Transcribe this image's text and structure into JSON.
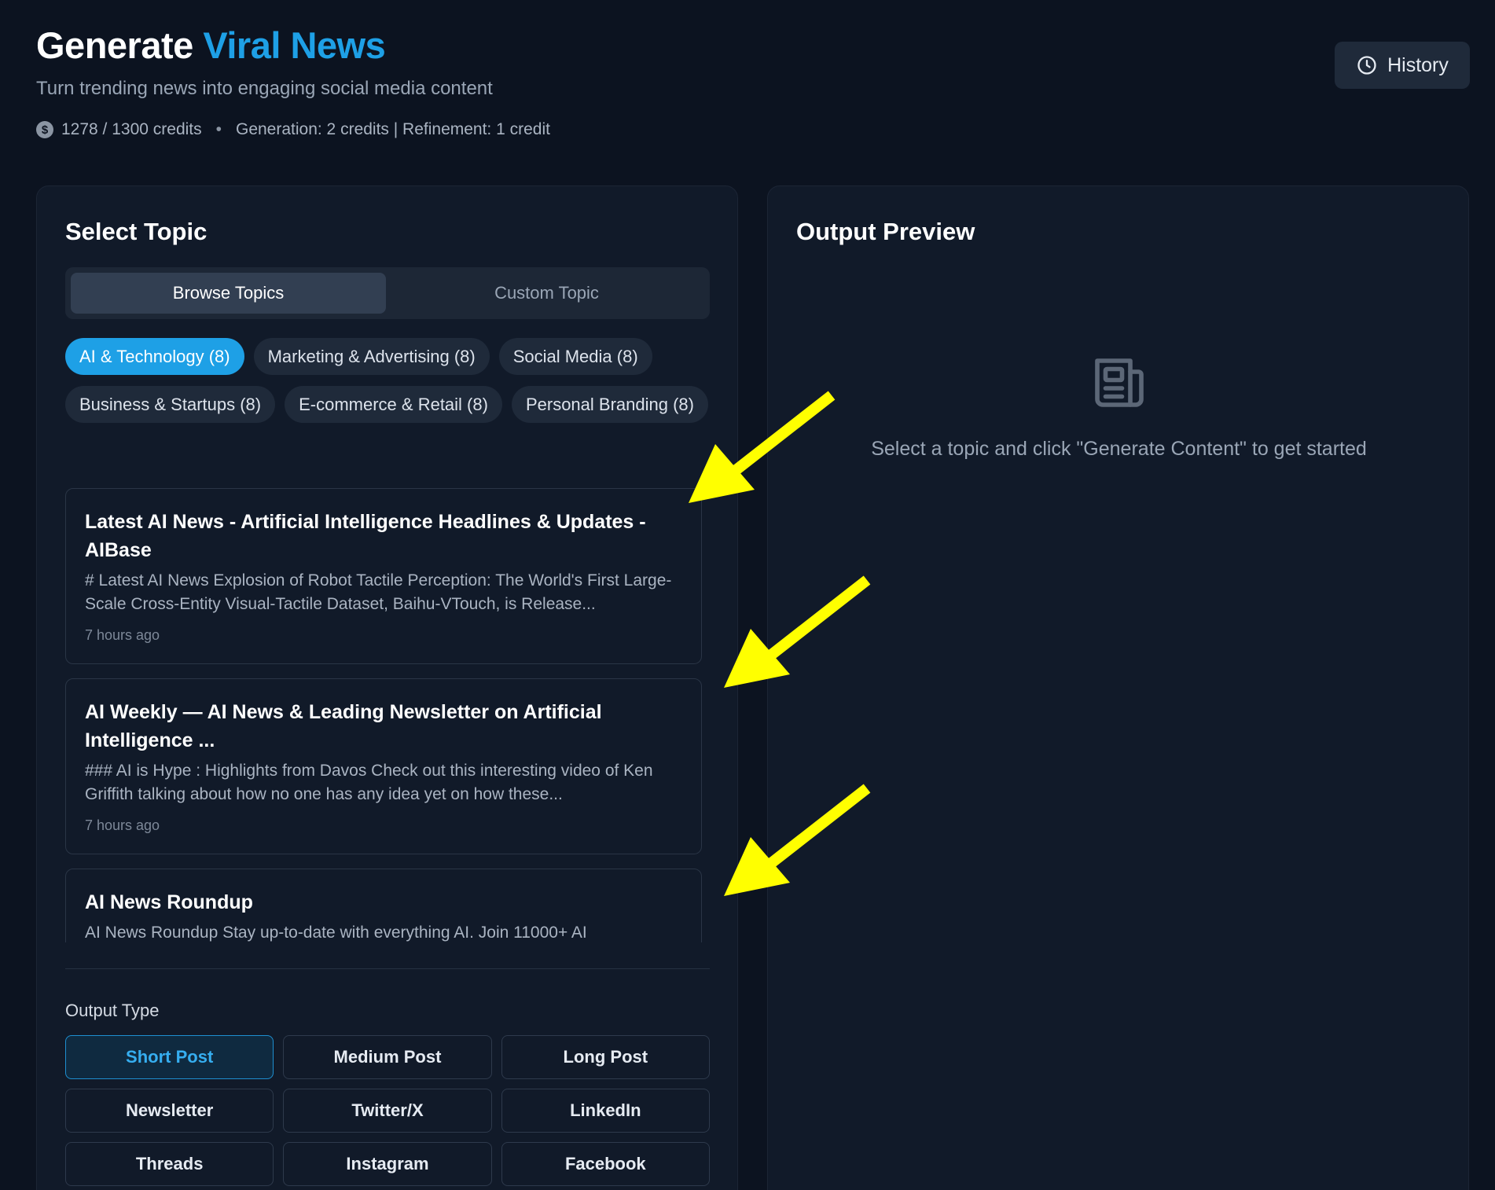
{
  "header": {
    "title_prefix": "Generate",
    "title_accent": "Viral News",
    "subtitle": "Turn trending news into engaging social media content",
    "credits_text": "1278 / 1300 credits",
    "costs_text": "Generation: 2 credits | Refinement: 1 credit",
    "coin_glyph": "$",
    "history_label": "History"
  },
  "select_topic": {
    "title": "Select Topic",
    "tabs": [
      {
        "label": "Browse Topics",
        "active": true
      },
      {
        "label": "Custom Topic",
        "active": false
      }
    ],
    "categories": [
      {
        "label": "AI & Technology (8)",
        "active": true
      },
      {
        "label": "Marketing & Advertising (8)",
        "active": false
      },
      {
        "label": "Social Media (8)",
        "active": false
      },
      {
        "label": "Business & Startups (8)",
        "active": false
      },
      {
        "label": "E-commerce & Retail (8)",
        "active": false
      },
      {
        "label": "Personal Branding (8)",
        "active": false
      }
    ],
    "news": [
      {
        "title": "Latest AI News - Artificial Intelligence Headlines & Updates - AIBase",
        "snippet": "# Latest AI News Explosion of Robot Tactile Perception: The World's First Large-Scale Cross-Entity Visual-Tactile Dataset, Baihu-VTouch, is Release...",
        "time": "7 hours ago"
      },
      {
        "title": "AI Weekly — AI News & Leading Newsletter on Artificial Intelligence ...",
        "snippet": "### AI is Hype : Highlights from Davos Check out this interesting video of Ken Griffith talking about how no one has any idea yet on how these...",
        "time": "7 hours ago"
      },
      {
        "title": "AI News Roundup",
        "snippet": "AI News Roundup Stay up-to-date with everything AI. Join 11000+ AI",
        "time": ""
      }
    ],
    "output_type_label": "Output Type",
    "output_types": [
      {
        "label": "Short Post",
        "active": true
      },
      {
        "label": "Medium Post",
        "active": false
      },
      {
        "label": "Long Post",
        "active": false
      },
      {
        "label": "Newsletter",
        "active": false
      },
      {
        "label": "Twitter/X",
        "active": false
      },
      {
        "label": "LinkedIn",
        "active": false
      },
      {
        "label": "Threads",
        "active": false
      },
      {
        "label": "Instagram",
        "active": false
      },
      {
        "label": "Facebook",
        "active": false
      }
    ]
  },
  "preview": {
    "title": "Output Preview",
    "icon": "newspaper-icon",
    "empty_text": "Select a topic and click \"Generate Content\" to get started"
  },
  "colors": {
    "background": "#0c1320",
    "panel": "#111a29",
    "accent": "#1ea0e6",
    "annotation_arrow": "#ffff00"
  }
}
